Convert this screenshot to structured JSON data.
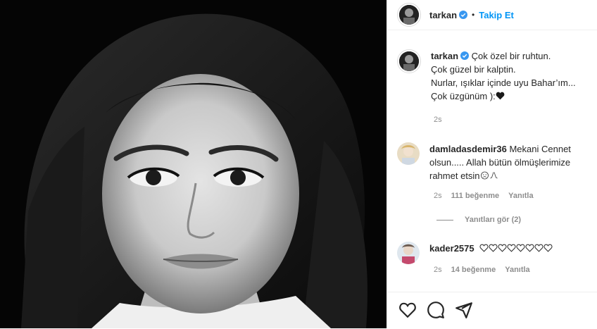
{
  "post": {
    "username": "tarkan",
    "follow_label": "Takip Et",
    "separator": "•"
  },
  "caption": {
    "username": "tarkan",
    "lines": [
      "Çok özel bir ruhtun.",
      "Çok güzel bir kalptin.",
      "Nurlar, ışıklar içinde uyu Bahar’ım...",
      "Çok üzgünüm ):"
    ],
    "time": "2s"
  },
  "comments": [
    {
      "username": "damladasdemir36",
      "text": "Mekani Cennet olsun..... Allah bütün ölmüşlerimize rahmet etsin",
      "time": "2s",
      "likes": "111 beğenme",
      "reply_label": "Yanıtla",
      "view_replies": "Yanıtları gör (2)"
    },
    {
      "username": "kader2575",
      "text": "",
      "time": "2s",
      "likes": "14 beğenme",
      "reply_label": "Yanıtla"
    }
  ],
  "icons": {
    "verified": "verified-badge-icon",
    "like": "heart-icon",
    "comment": "comment-icon",
    "share": "share-icon"
  },
  "colors": {
    "accent": "#0095f6",
    "muted": "#8e8e8e",
    "text": "#262626"
  }
}
